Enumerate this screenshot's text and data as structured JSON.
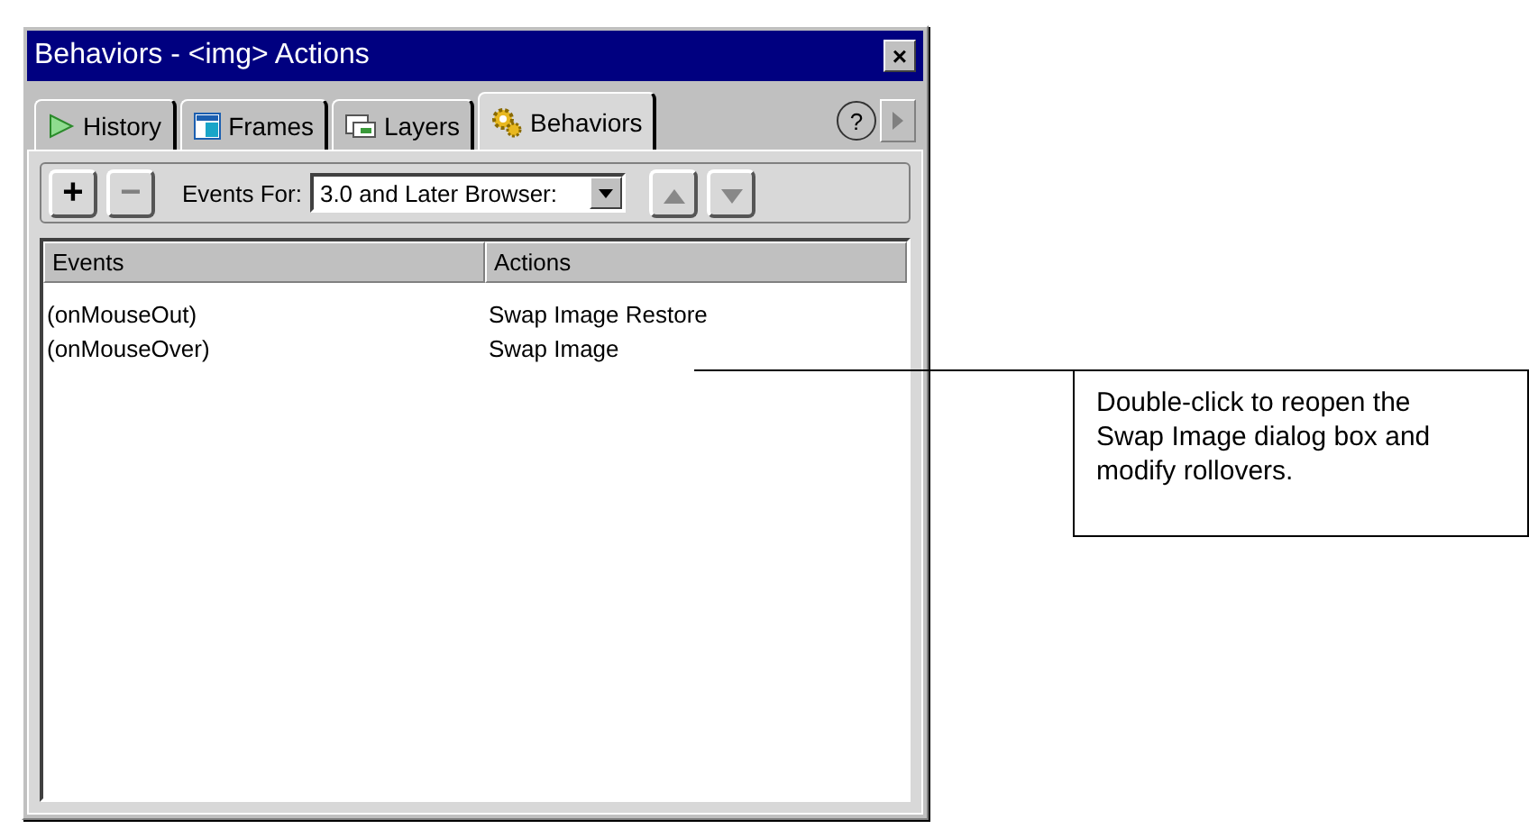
{
  "window": {
    "title": "Behaviors - <img> Actions",
    "close": "×"
  },
  "tabs": [
    {
      "label": "History",
      "selected": false
    },
    {
      "label": "Frames",
      "selected": false
    },
    {
      "label": "Layers",
      "selected": false
    },
    {
      "label": "Behaviors",
      "selected": true
    }
  ],
  "help": "?",
  "toolbar": {
    "add": "+",
    "remove": "−",
    "events_for_label": "Events For:",
    "events_for_value": "3.0 and Later Browser:"
  },
  "table": {
    "columns": [
      "Events",
      "Actions"
    ],
    "rows": [
      {
        "event": "(onMouseOut)",
        "action": "Swap Image Restore"
      },
      {
        "event": "(onMouseOver)",
        "action": "Swap Image"
      }
    ]
  },
  "callout": {
    "text": "Double-click to reopen the Swap Image dialog box and modify rollovers."
  }
}
